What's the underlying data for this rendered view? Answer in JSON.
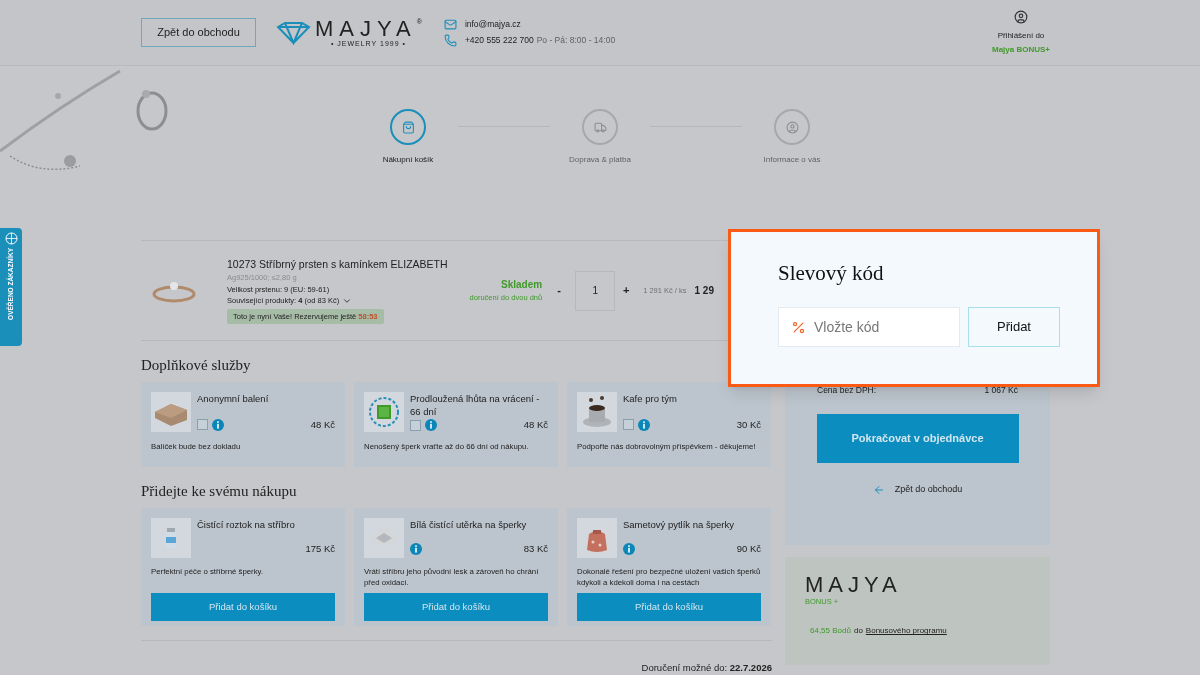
{
  "header": {
    "back_button": "Zpět do obchodu",
    "logo": {
      "wordmark": "MAJYA",
      "registered": "®",
      "tagline": "• JEWELRY 1999 •"
    },
    "email": "info@majya.cz",
    "phone": "+420 555 222 700",
    "hours": "Po - Pá: 8:00 - 14:00",
    "login": {
      "line1": "Přihlášení do",
      "line2": "Majya BONUS+"
    }
  },
  "steps": [
    {
      "label": "Nákupní košík",
      "kind": "bag",
      "selected": true
    },
    {
      "label": "Doprava & platba",
      "kind": "truck",
      "selected": false
    },
    {
      "label": "Informace o vás",
      "kind": "user",
      "selected": false
    }
  ],
  "trust_badge": "OVĚŘENO ZÁKAZNÍKY",
  "cart_item": {
    "title": "10273 Stříbrný prsten s kamínkem ELIZABETH",
    "material": "Ag925/1000; ≤2,80 g",
    "size": "Velikost prstenu: 9 (EU: 59-61)",
    "related": "Související produkty: **4** (od 83 Kč)",
    "reservation": "Toto je nyní Vaše! Rezervujeme ještě",
    "timer": "58:53",
    "stock": "Skladem",
    "delivery": "doručení do dvou dnů",
    "minus": "-",
    "quantity": "1",
    "plus": "+",
    "unit_price": "1 291 Kč / ks",
    "total": "1 29"
  },
  "services": {
    "title": "Doplňkové služby",
    "items": [
      {
        "name": "Anonymní balení",
        "price": "48 Kč",
        "checked": false,
        "description": "Balíček bude bez dokladu"
      },
      {
        "name": "Prodloužená lhůta na vrácení - 66 dní",
        "price": "48 Kč",
        "checked": false,
        "description": "Nenošený šperk vraťte až do 66 dní od nákupu."
      },
      {
        "name": "Kafe pro tým",
        "price": "30 Kč",
        "checked": false,
        "description": "Podpořte nás dobrovolným příspěvkem - děkujeme!"
      }
    ]
  },
  "addons": {
    "title": "Přidejte ke svému nákupu",
    "items": [
      {
        "name": "Čistící roztok na stříbro",
        "price": "175 Kč",
        "info": false,
        "description": "Perfektní péče o stříbrné šperky.",
        "button": "Přidat do košíku"
      },
      {
        "name": "Bílá čistící utěrka na šperky",
        "price": "83 Kč",
        "info": true,
        "description": "Vrátí stříbru jeho původní lesk a zároveň ho chrání před oxidací.",
        "button": "Přidat do košíku"
      },
      {
        "name": "Sametový pytlík na šperky",
        "price": "90 Kč",
        "info": true,
        "description": "Dokonalé řešení pro bezpečné uložení vašich šperků kdykoli a kdekoli doma i na cestách",
        "button": "Přidat do košíku"
      }
    ]
  },
  "delivery": "Doručení možné do: **22.7.2026**",
  "summary": {
    "net_label": "Cena bez DPH:",
    "net_value": "1 067 Kč",
    "continue_button": "Pokračovat v objednávce",
    "back_link": "Zpět do obchodu"
  },
  "bonus": {
    "wordmark": "MAJYA",
    "sub": "BONUS +",
    "points": "64,55 Bodů",
    "text": "do",
    "link": "Bonusového programu"
  },
  "discount_popup": {
    "title": "Slevový kód",
    "placeholder": "Vložte kód",
    "button": "Přidat"
  }
}
